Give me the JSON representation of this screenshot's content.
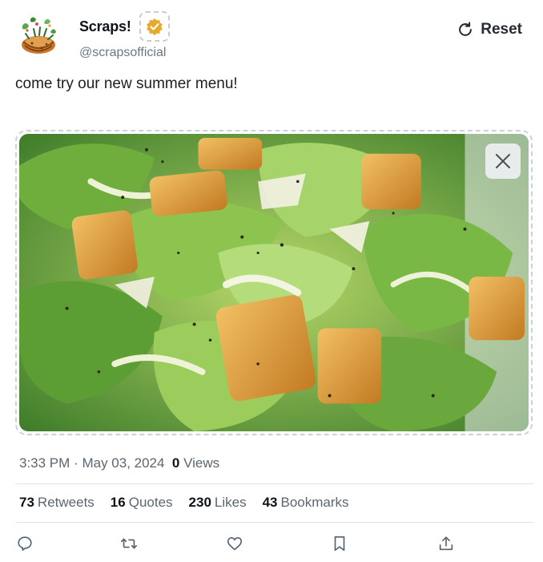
{
  "profile": {
    "display_name": "Scraps!",
    "handle": "@scrapsofficial",
    "verified_badge_color": "#e8a92b",
    "avatar_icon": "bird-nest-logo-icon"
  },
  "header": {
    "reset_label": "Reset",
    "reset_icon": "refresh-icon"
  },
  "tweet": {
    "text": "come try our new summer menu!"
  },
  "media": {
    "description_icon": "salad-photo",
    "close_icon": "close-icon"
  },
  "meta": {
    "time": "3:33 PM",
    "separator": "·",
    "date": "May 03, 2024",
    "views_count": "0",
    "views_label": "Views"
  },
  "stats": {
    "retweets_count": "73",
    "retweets_label": "Retweets",
    "quotes_count": "16",
    "quotes_label": "Quotes",
    "likes_count": "230",
    "likes_label": "Likes",
    "bookmarks_count": "43",
    "bookmarks_label": "Bookmarks"
  },
  "actions": {
    "reply_icon": "reply-icon",
    "retweet_icon": "retweet-icon",
    "like_icon": "heart-icon",
    "bookmark_icon": "bookmark-icon",
    "share_icon": "share-icon"
  },
  "colors": {
    "text_primary": "#0f1419",
    "text_secondary": "#5b6670",
    "divider": "#e1e5e9"
  }
}
